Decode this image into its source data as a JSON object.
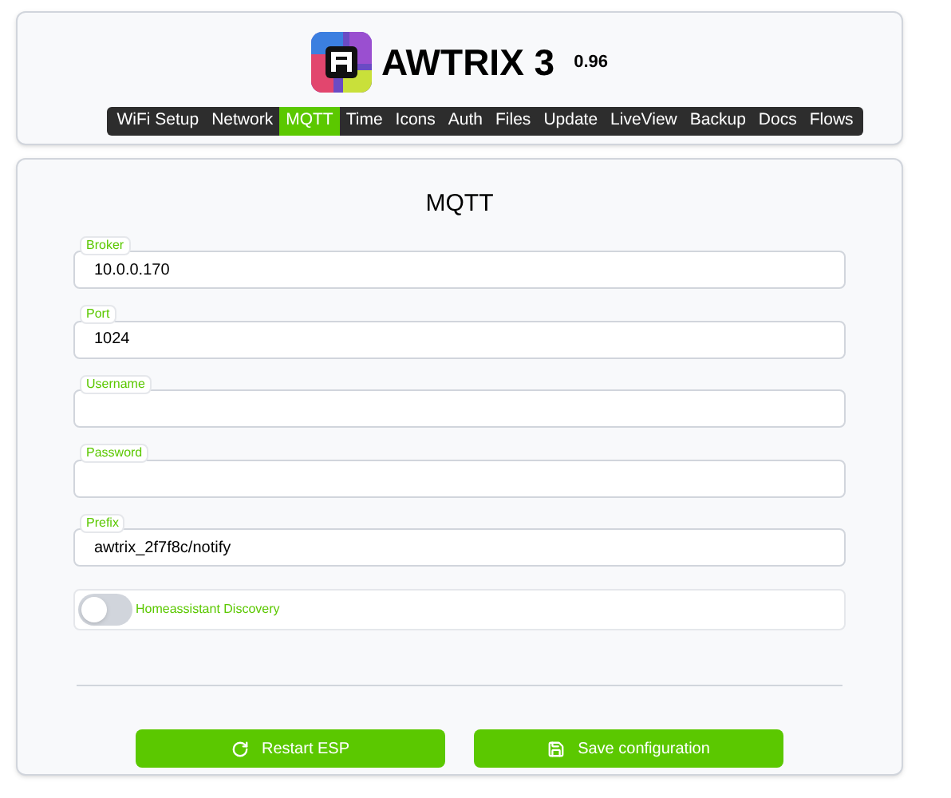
{
  "header": {
    "title": "AWTRIX 3",
    "version": "0.96"
  },
  "nav": [
    {
      "label": "WiFi Setup",
      "selected": false
    },
    {
      "label": "Network",
      "selected": false
    },
    {
      "label": "MQTT",
      "selected": true
    },
    {
      "label": "Time",
      "selected": false
    },
    {
      "label": "Icons",
      "selected": false
    },
    {
      "label": "Auth",
      "selected": false
    },
    {
      "label": "Files",
      "selected": false
    },
    {
      "label": "Update",
      "selected": false
    },
    {
      "label": "LiveView",
      "selected": false
    },
    {
      "label": "Backup",
      "selected": false
    },
    {
      "label": "Docs",
      "selected": false
    },
    {
      "label": "Flows",
      "selected": false
    }
  ],
  "form": {
    "title": "MQTT",
    "fields": [
      {
        "label": "Broker",
        "value": "10.0.0.170"
      },
      {
        "label": "Port",
        "value": "1024"
      },
      {
        "label": "Username"
      },
      {
        "label": "Password"
      },
      {
        "label": "Prefix",
        "value": "awtrix_2f7f8c/notify"
      }
    ],
    "toggle": {
      "label": "Homeassistant Discovery",
      "on": false
    }
  },
  "buttons": [
    {
      "kind": "restart",
      "label": "Restart ESP"
    },
    {
      "kind": "save",
      "label": "Save configuration"
    }
  ]
}
